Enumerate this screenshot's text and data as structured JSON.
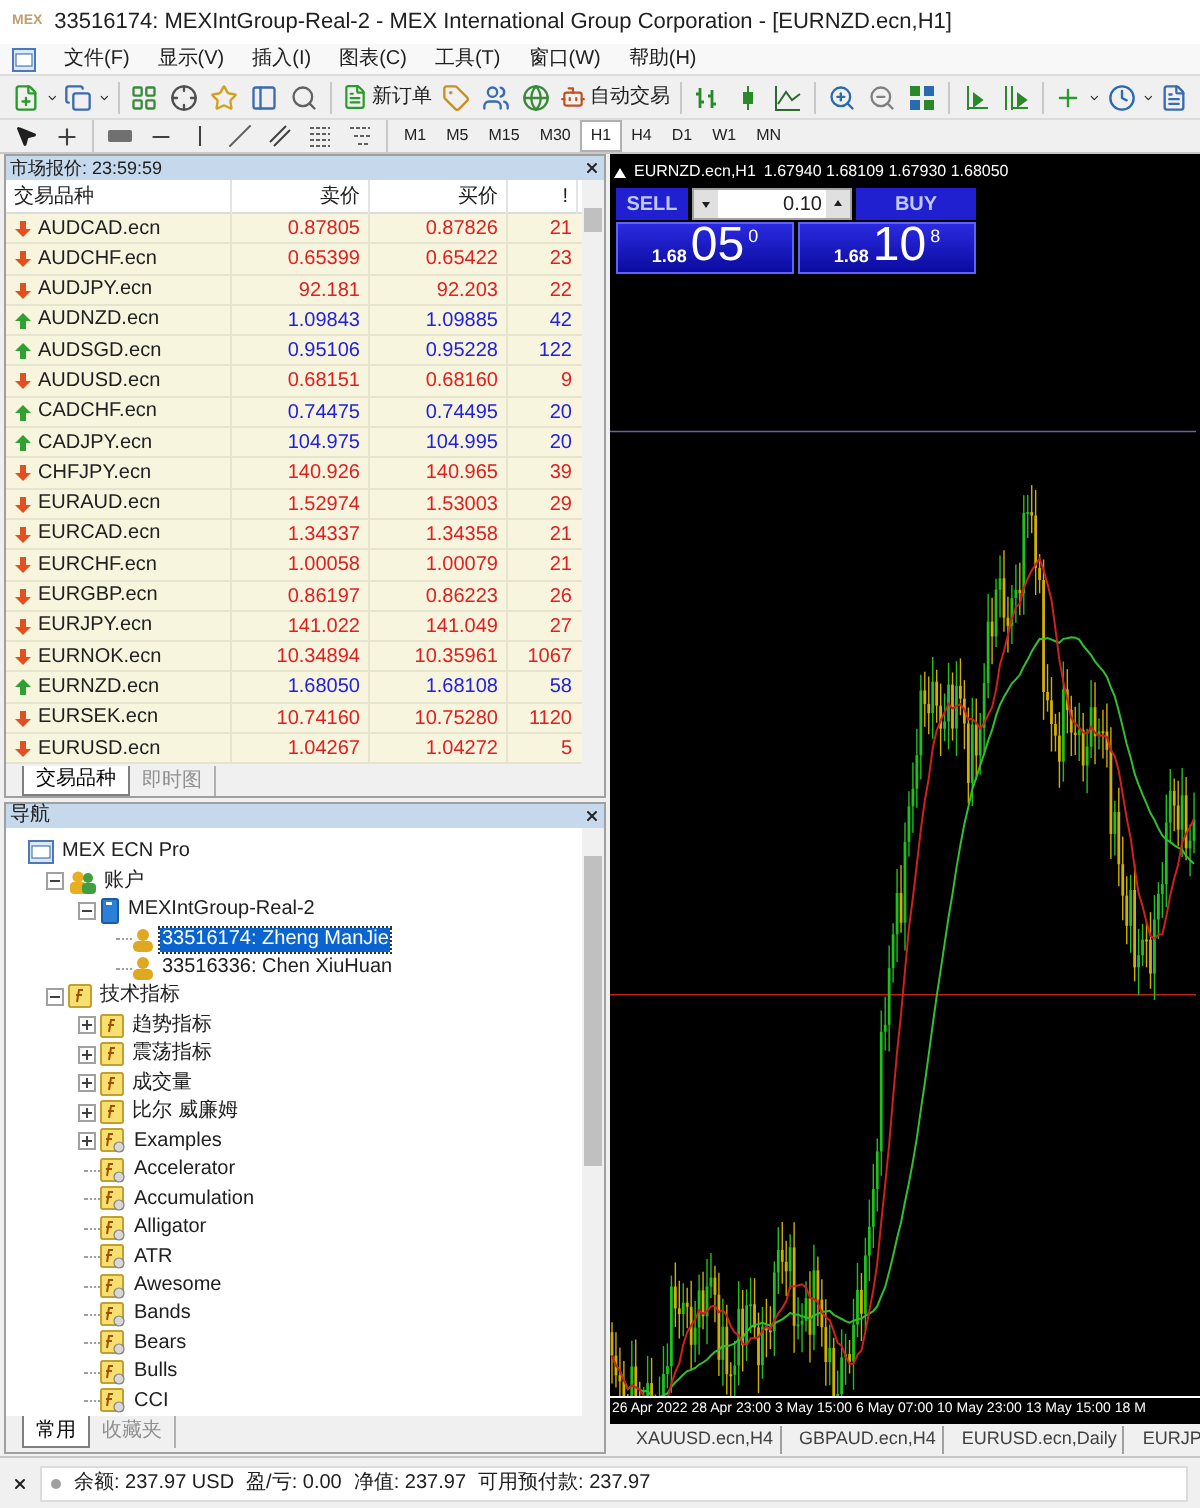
{
  "window": {
    "logo": "MEX",
    "title": "33516174: MEXIntGroup-Real-2 - MEX International Group Corporation - [EURNZD.ecn,H1]"
  },
  "menu": [
    "文件(F)",
    "显示(V)",
    "插入(I)",
    "图表(C)",
    "工具(T)",
    "窗口(W)",
    "帮助(H)"
  ],
  "toolbar": {
    "new_order": "新订单",
    "auto_trading": "自动交易"
  },
  "timeframes": [
    {
      "label": "M1",
      "selected": false
    },
    {
      "label": "M5",
      "selected": false
    },
    {
      "label": "M15",
      "selected": false
    },
    {
      "label": "M30",
      "selected": false
    },
    {
      "label": "H1",
      "selected": true
    },
    {
      "label": "H4",
      "selected": false
    },
    {
      "label": "D1",
      "selected": false
    },
    {
      "label": "W1",
      "selected": false
    },
    {
      "label": "MN",
      "selected": false
    }
  ],
  "market_watch": {
    "title": "市场报价: 23:59:59",
    "columns": [
      "交易品种",
      "卖价",
      "买价",
      "!"
    ],
    "rows": [
      {
        "symbol": "AUDCAD.ecn",
        "bid": "0.87805",
        "ask": "0.87826",
        "spread": "21",
        "kind": "down"
      },
      {
        "symbol": "AUDCHF.ecn",
        "bid": "0.65399",
        "ask": "0.65422",
        "spread": "23",
        "kind": "down"
      },
      {
        "symbol": "AUDJPY.ecn",
        "bid": "92.181",
        "ask": "92.203",
        "spread": "22",
        "kind": "down"
      },
      {
        "symbol": "AUDNZD.ecn",
        "bid": "1.09843",
        "ask": "1.09885",
        "spread": "42",
        "kind": "up"
      },
      {
        "symbol": "AUDSGD.ecn",
        "bid": "0.95106",
        "ask": "0.95228",
        "spread": "122",
        "kind": "up"
      },
      {
        "symbol": "AUDUSD.ecn",
        "bid": "0.68151",
        "ask": "0.68160",
        "spread": "9",
        "kind": "down"
      },
      {
        "symbol": "CADCHF.ecn",
        "bid": "0.74475",
        "ask": "0.74495",
        "spread": "20",
        "kind": "up"
      },
      {
        "symbol": "CADJPY.ecn",
        "bid": "104.975",
        "ask": "104.995",
        "spread": "20",
        "kind": "up"
      },
      {
        "symbol": "CHFJPY.ecn",
        "bid": "140.926",
        "ask": "140.965",
        "spread": "39",
        "kind": "down"
      },
      {
        "symbol": "EURAUD.ecn",
        "bid": "1.52974",
        "ask": "1.53003",
        "spread": "29",
        "kind": "down"
      },
      {
        "symbol": "EURCAD.ecn",
        "bid": "1.34337",
        "ask": "1.34358",
        "spread": "21",
        "kind": "down"
      },
      {
        "symbol": "EURCHF.ecn",
        "bid": "1.00058",
        "ask": "1.00079",
        "spread": "21",
        "kind": "down"
      },
      {
        "symbol": "EURGBP.ecn",
        "bid": "0.86197",
        "ask": "0.86223",
        "spread": "26",
        "kind": "down"
      },
      {
        "symbol": "EURJPY.ecn",
        "bid": "141.022",
        "ask": "141.049",
        "spread": "27",
        "kind": "down"
      },
      {
        "symbol": "EURNOK.ecn",
        "bid": "10.34894",
        "ask": "10.35961",
        "spread": "1067",
        "kind": "down"
      },
      {
        "symbol": "EURNZD.ecn",
        "bid": "1.68050",
        "ask": "1.68108",
        "spread": "58",
        "kind": "up"
      },
      {
        "symbol": "EURSEK.ecn",
        "bid": "10.74160",
        "ask": "10.75280",
        "spread": "1120",
        "kind": "down"
      },
      {
        "symbol": "EURUSD.ecn",
        "bid": "1.04267",
        "ask": "1.04272",
        "spread": "5",
        "kind": "down"
      }
    ],
    "tabs": [
      {
        "label": "交易品种",
        "selected": true
      },
      {
        "label": "即时图",
        "selected": false
      }
    ]
  },
  "navigator": {
    "title": "导航",
    "tree": [
      {
        "label": "MEX ECN Pro",
        "kind": "terminal",
        "selected": false,
        "children": [
          {
            "label": "账户",
            "kind": "accounts",
            "expanded": true,
            "selected": false,
            "children": [
              {
                "label": "MEXIntGroup-Real-2",
                "kind": "server",
                "expanded": true,
                "selected": false,
                "children": [
                  {
                    "label": "33516174: Zheng ManJie",
                    "kind": "account",
                    "selected": true
                  },
                  {
                    "label": "33516336: Chen XiuHuan",
                    "kind": "account",
                    "selected": false
                  }
                ]
              }
            ]
          },
          {
            "label": "技术指标",
            "kind": "folder",
            "expanded": true,
            "selected": false,
            "children": [
              {
                "label": "趋势指标",
                "kind": "folder",
                "expanded": false,
                "selected": false
              },
              {
                "label": "震荡指标",
                "kind": "folder",
                "expanded": false,
                "selected": false
              },
              {
                "label": "成交量",
                "kind": "folder",
                "expanded": false,
                "selected": false
              },
              {
                "label": "比尔 威廉姆",
                "kind": "folder",
                "expanded": false,
                "selected": false
              },
              {
                "label": "Examples",
                "kind": "indicator",
                "expanded": false,
                "selected": false
              },
              {
                "label": "Accelerator",
                "kind": "indicator",
                "selected": false
              },
              {
                "label": "Accumulation",
                "kind": "indicator",
                "selected": false
              },
              {
                "label": "Alligator",
                "kind": "indicator",
                "selected": false
              },
              {
                "label": "ATR",
                "kind": "indicator",
                "selected": false
              },
              {
                "label": "Awesome",
                "kind": "indicator",
                "selected": false
              },
              {
                "label": "Bands",
                "kind": "indicator",
                "selected": false
              },
              {
                "label": "Bears",
                "kind": "indicator",
                "selected": false
              },
              {
                "label": "Bulls",
                "kind": "indicator",
                "selected": false
              },
              {
                "label": "CCI",
                "kind": "indicator",
                "selected": false
              }
            ]
          }
        ]
      }
    ],
    "tabs": [
      {
        "label": "常用",
        "selected": true
      },
      {
        "label": "收藏夹",
        "selected": false
      }
    ]
  },
  "chart": {
    "info_symbol": "EURNZD.ecn,H1",
    "info_prices": "1.67940 1.68109 1.67930 1.68050",
    "trade": {
      "sell": "SELL",
      "buy": "BUY",
      "lot": "0.10",
      "sell_price": {
        "prefix": "1.68",
        "main": "05",
        "suffix": "0"
      },
      "buy_price": {
        "prefix": "1.68",
        "main": "10",
        "suffix": "8"
      }
    },
    "x_labels": [
      "26 Apr 2022",
      "28 Apr 23:00",
      "3 May 15:00",
      "6 May 07:00",
      "10 May 23:00",
      "13 May 15:00",
      "18 M"
    ]
  },
  "chart_tabs": [
    "XAUUSD.ecn,H4",
    "GBPAUD.ecn,H4",
    "EURUSD.ecn,Daily",
    "EURJP"
  ],
  "status": [
    "余额: 237.97 USD",
    "盈/亏: 0.00",
    "净值: 237.97",
    "可用预付款: 237.97"
  ]
}
